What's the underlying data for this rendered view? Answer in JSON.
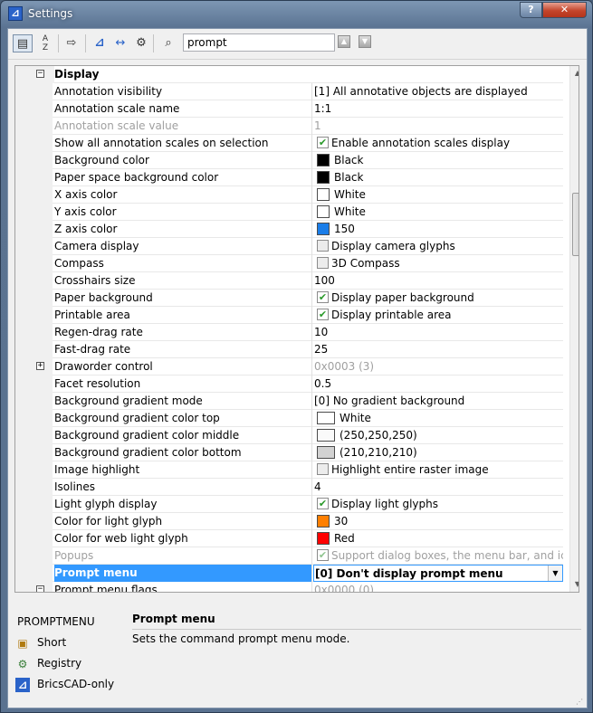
{
  "window": {
    "title": "Settings",
    "help_label": "?",
    "close_label": "✕"
  },
  "toolbar": {
    "search_value": "prompt",
    "search_placeholder": ""
  },
  "rows": [
    {
      "name": "Display",
      "value": "",
      "kind": "category",
      "expander": "minus"
    },
    {
      "name": "Annotation visibility",
      "value": "[1] All annotative objects are displayed"
    },
    {
      "name": "Annotation scale name",
      "value": "1:1"
    },
    {
      "name": "Annotation scale value",
      "value": "1",
      "disabled": true
    },
    {
      "name": "Show all annotation scales on selection",
      "value": "Enable annotation scales display",
      "check": true
    },
    {
      "name": "Background color",
      "value": "Black",
      "swatch": "#000000"
    },
    {
      "name": "Paper space background color",
      "value": "Black",
      "swatch": "#000000"
    },
    {
      "name": "X axis color",
      "value": "White",
      "swatch": "#ffffff"
    },
    {
      "name": "Y axis color",
      "value": "White",
      "swatch": "#ffffff"
    },
    {
      "name": "Z axis color",
      "value": "150",
      "swatch": "#1a7de8"
    },
    {
      "name": "Camera display",
      "value": "Display camera glyphs",
      "check": false
    },
    {
      "name": "Compass",
      "value": "3D Compass",
      "check": false
    },
    {
      "name": "Crosshairs size",
      "value": "100"
    },
    {
      "name": "Paper background",
      "value": "Display paper background",
      "check": true
    },
    {
      "name": "Printable area",
      "value": "Display printable area",
      "check": true
    },
    {
      "name": "Regen-drag rate",
      "value": "10"
    },
    {
      "name": "Fast-drag rate",
      "value": "25"
    },
    {
      "name": "Draworder control",
      "value": "0x0003 (3)",
      "expander": "plus",
      "valueDisabled": true
    },
    {
      "name": "Facet resolution",
      "value": "0.5"
    },
    {
      "name": "Background gradient mode",
      "value": "[0] No gradient background"
    },
    {
      "name": "Background gradient color top",
      "value": "White",
      "swatch": "#ffffff",
      "wide": true
    },
    {
      "name": "Background gradient color middle",
      "value": "(250,250,250)",
      "swatch": "#fafafa",
      "wide": true
    },
    {
      "name": "Background gradient color bottom",
      "value": "(210,210,210)",
      "swatch": "#d2d2d2",
      "wide": true
    },
    {
      "name": "Image highlight",
      "value": "Highlight entire raster image",
      "check": false
    },
    {
      "name": "Isolines",
      "value": "4"
    },
    {
      "name": "Light glyph display",
      "value": "Display light glyphs",
      "check": true
    },
    {
      "name": "Color for light glyph",
      "value": "30",
      "swatch": "#ff7f00"
    },
    {
      "name": "Color for web light glyph",
      "value": "Red",
      "swatch": "#ff0000"
    },
    {
      "name": "Popups",
      "value": "Support dialog boxes, the menu bar, and icon menus",
      "check": true,
      "disabled": true
    },
    {
      "name": "Prompt menu",
      "value": "[0] Don't display prompt menu",
      "selected": true,
      "dropdown": true
    },
    {
      "name": "Prompt menu flags",
      "value": "0x0000 (0)",
      "expander": "minus",
      "valueDisabled": true
    }
  ],
  "info": {
    "variable": "PROMPTMENU",
    "title": "Prompt menu",
    "description": "Sets the command prompt menu mode.",
    "items": [
      {
        "label": "Short",
        "icon": "short-icon"
      },
      {
        "label": "Registry",
        "icon": "registry-icon"
      },
      {
        "label": "BricsCAD-only",
        "icon": "bricscad-icon"
      }
    ]
  }
}
